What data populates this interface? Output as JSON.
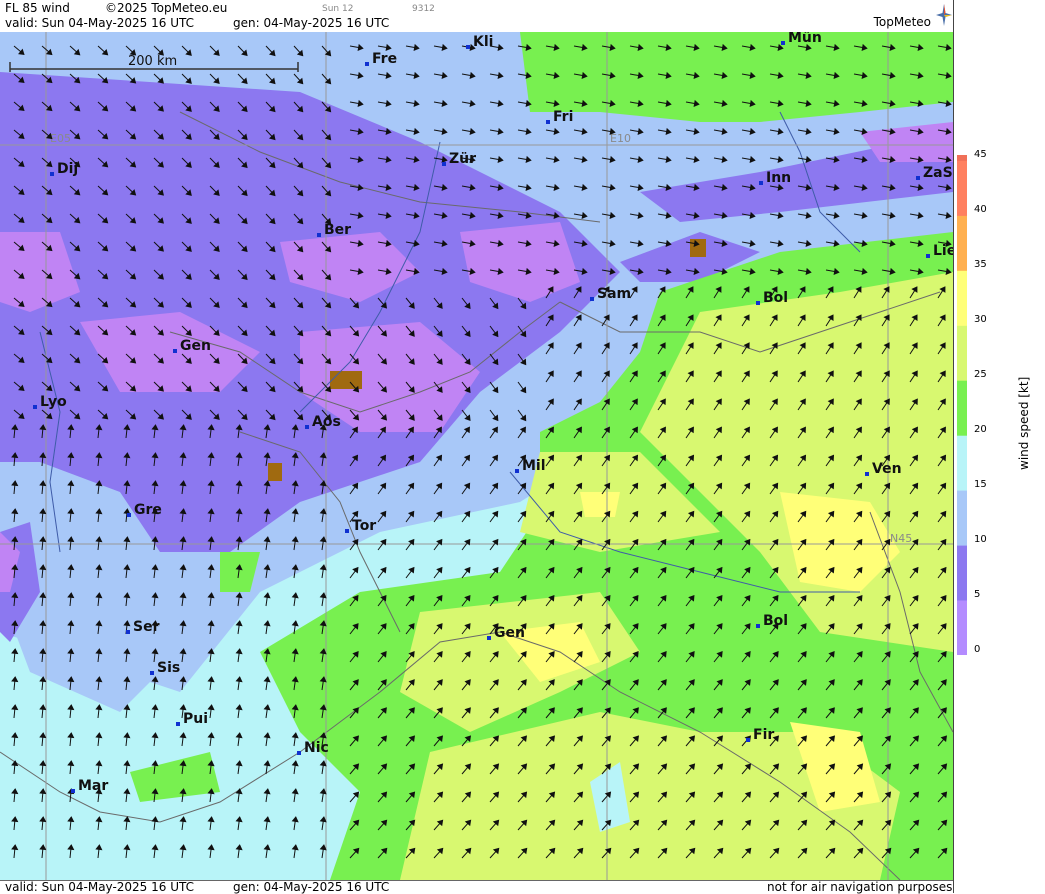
{
  "header": {
    "product": "FL 85 wind",
    "copyright": "©2025 TopMeteo.eu",
    "run_day": "Sun 12",
    "code": "9312",
    "valid": "valid:  Sun  04-May-2025  16 UTC",
    "generated": "gen: 04-May-2025 16 UTC",
    "logo": "TopMeteo"
  },
  "footer": {
    "valid": "valid:  Sun  04-May-2025  16 UTC",
    "generated": "gen: 04-May-2025 16 UTC",
    "disclaimer": "not for air navigation purposes"
  },
  "scale": {
    "label": "200 km"
  },
  "grid_labels": {
    "e05": "E05",
    "e10": "E10",
    "n45": "N45"
  },
  "legend": {
    "title": "wind speed [kt]",
    "ticks": [
      "45",
      "40",
      "35",
      "30",
      "25",
      "20",
      "15",
      "10",
      "5",
      "0"
    ],
    "colors": [
      "#b48cff",
      "#8c78f0",
      "#a8c8f8",
      "#b8f4f8",
      "#78f050",
      "#d8f870",
      "#ffff78",
      "#ffb050",
      "#ff8060",
      "#f07058"
    ]
  },
  "cities": [
    {
      "name": "Kli"
    },
    {
      "name": "Mün"
    },
    {
      "name": "Fre"
    },
    {
      "name": "Fri"
    },
    {
      "name": "Dij"
    },
    {
      "name": "Zür"
    },
    {
      "name": "Inn"
    },
    {
      "name": "ZaS"
    },
    {
      "name": "Ber"
    },
    {
      "name": "Lie"
    },
    {
      "name": "Sam"
    },
    {
      "name": "Bol"
    },
    {
      "name": "Gen"
    },
    {
      "name": "Lyo"
    },
    {
      "name": "Aos"
    },
    {
      "name": "Mil"
    },
    {
      "name": "Ven"
    },
    {
      "name": "Gre"
    },
    {
      "name": "Tor"
    },
    {
      "name": "Ser"
    },
    {
      "name": "Bol"
    },
    {
      "name": "Gen"
    },
    {
      "name": "Sis"
    },
    {
      "name": "Pui"
    },
    {
      "name": "Nic"
    },
    {
      "name": "Fir"
    },
    {
      "name": "Mar"
    }
  ],
  "colors": {
    "bg_light": "#b8f4f8",
    "blue_mid": "#a8c8f8",
    "purple": "#8c78f0",
    "violet": "#c084f4",
    "green": "#78f050",
    "yellowgreen": "#d8f870",
    "yellow": "#ffff78",
    "terrain": "#a06a10"
  }
}
